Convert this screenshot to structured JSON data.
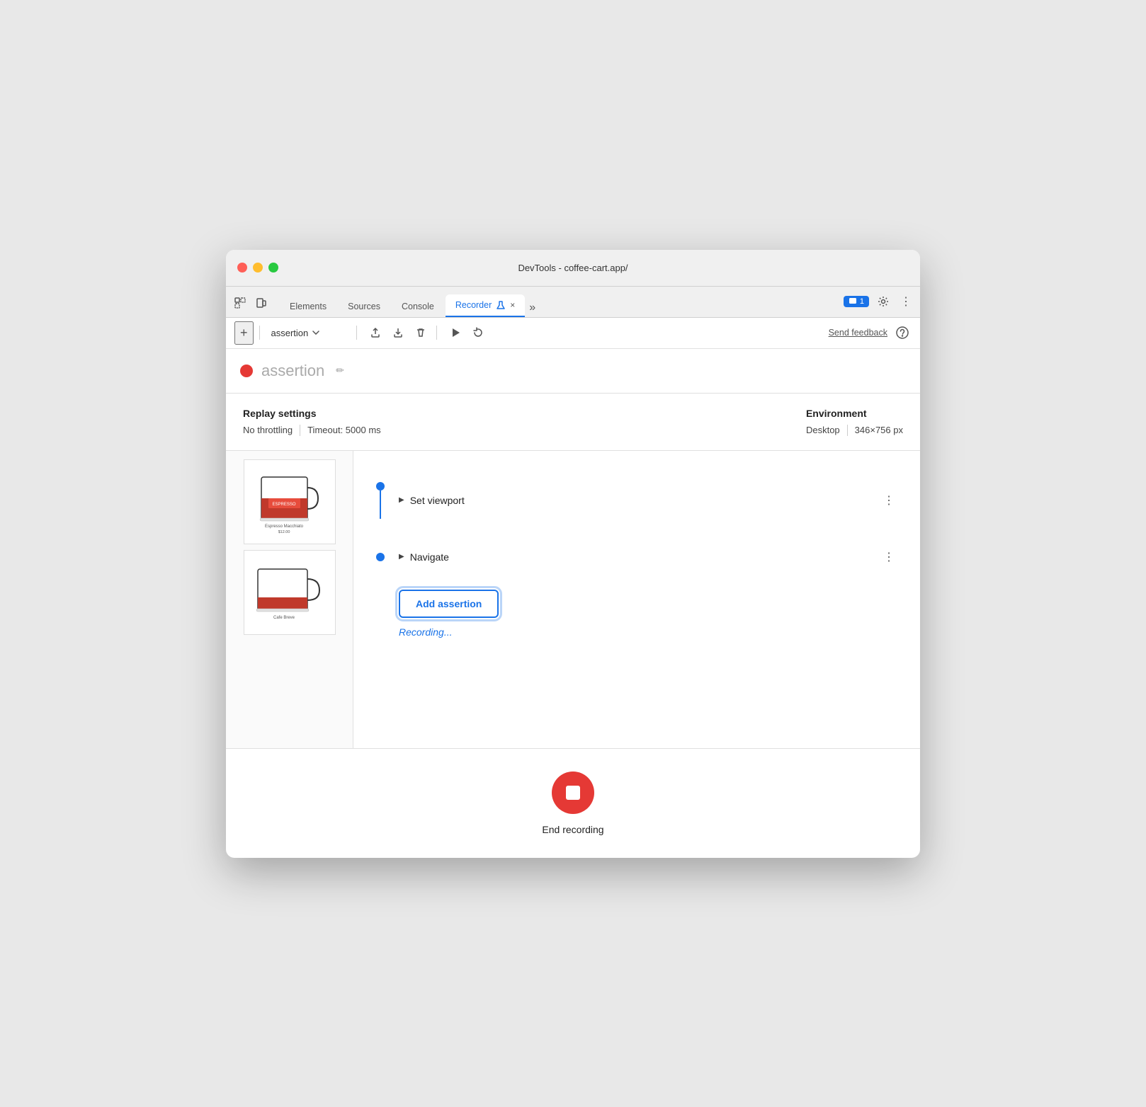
{
  "window": {
    "title": "DevTools - coffee-cart.app/"
  },
  "tabs": [
    {
      "label": "Elements",
      "active": false
    },
    {
      "label": "Sources",
      "active": false
    },
    {
      "label": "Console",
      "active": false
    },
    {
      "label": "Recorder",
      "active": true
    },
    {
      "label": "×",
      "active": false
    }
  ],
  "toolbar": {
    "add_label": "+",
    "dropdown_value": "assertion",
    "send_feedback": "Send feedback"
  },
  "recording": {
    "dot_color": "#e53935",
    "title": "assertion",
    "edit_hint": "✏"
  },
  "settings": {
    "left_label": "Replay settings",
    "throttle": "No throttling",
    "timeout": "Timeout: 5000 ms",
    "right_label": "Environment",
    "viewport": "Desktop",
    "dimensions": "346×756 px"
  },
  "steps": [
    {
      "label": "Set viewport",
      "has_line": true
    },
    {
      "label": "Navigate",
      "has_line": false
    }
  ],
  "add_assertion": {
    "button_label": "Add assertion",
    "status": "Recording..."
  },
  "end_recording": {
    "label": "End recording"
  },
  "notifications": {
    "count": "1"
  }
}
